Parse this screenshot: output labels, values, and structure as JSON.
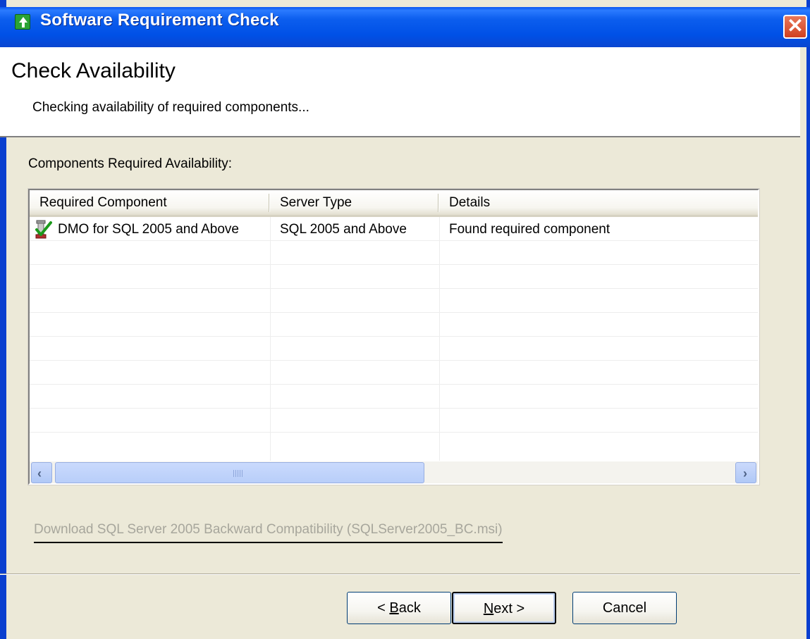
{
  "window": {
    "title": "Software Requirement Check",
    "close_label": "✕"
  },
  "header": {
    "title": "Check Availability",
    "subtitle": "Checking availability of required components..."
  },
  "section_label": "Components Required Availability:",
  "table": {
    "columns": [
      "Required Component",
      "Server Type",
      "Details"
    ],
    "rows": [
      {
        "component": "DMO for SQL 2005 and Above",
        "server_type": "SQL 2005  and Above",
        "details": "Found required component",
        "status_icon": "check-ok-icon"
      }
    ]
  },
  "scrollbar": {
    "left_arrow": "‹",
    "right_arrow": "›",
    "position": 0.0
  },
  "download_link": "Download SQL Server 2005 Backward Compatibility (SQLServer2005_BC.msi)",
  "buttons": {
    "back_prefix": "< ",
    "back_accel": "B",
    "back_rest": "ack",
    "next_accel": "N",
    "next_rest": "ext >",
    "cancel": "Cancel"
  }
}
